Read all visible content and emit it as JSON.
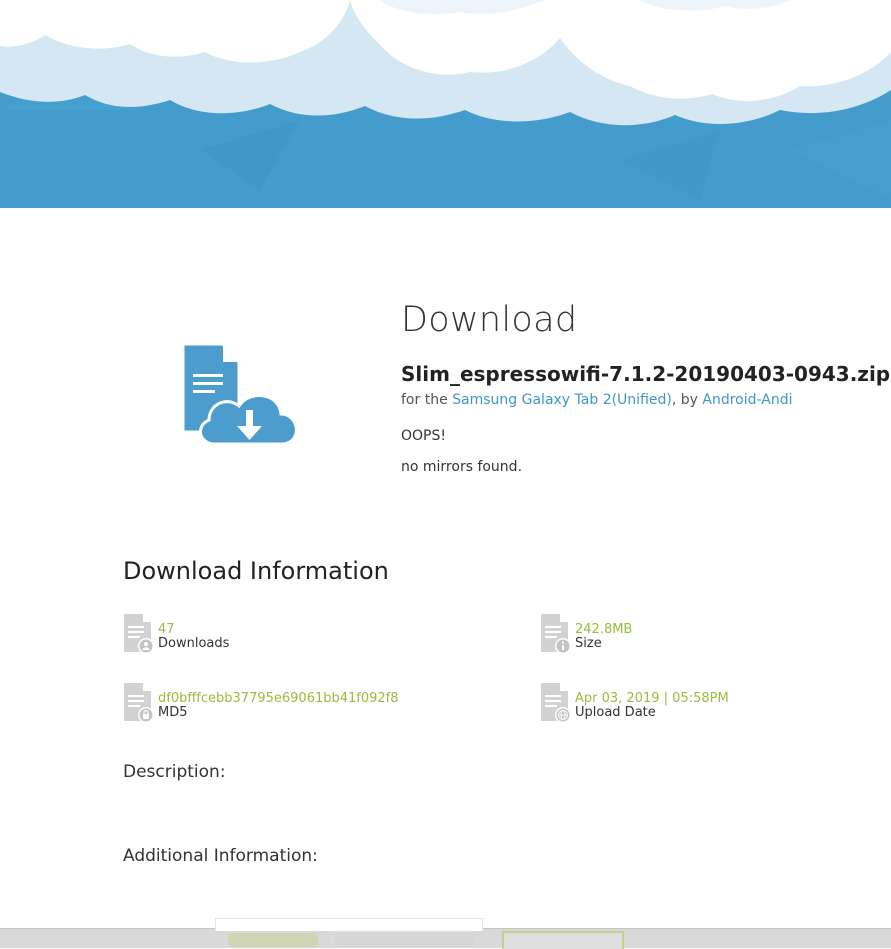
{
  "download": {
    "title": "Download",
    "filename": "Slim_espressowifi-7.1.2-20190403-0943.zip",
    "for_prefix": "for the ",
    "device_link": "Samsung Galaxy Tab 2(Unified)",
    "by_text": ", by ",
    "author_link": "Android-Andi",
    "oops": "OOPS!",
    "no_mirrors": "no mirrors found."
  },
  "info": {
    "title": "Download Information",
    "items": [
      {
        "value": "47",
        "label": "Downloads",
        "badge": "user-icon"
      },
      {
        "value": "242.8MB",
        "label": "Size",
        "badge": "info-icon"
      },
      {
        "value": "df0bfffcebb37795e69061bb41f092f8",
        "label": "MD5",
        "badge": "lock-icon"
      },
      {
        "value": "Apr 03, 2019 | 05:58PM",
        "label": "Upload Date",
        "badge": "globe-icon"
      }
    ]
  },
  "sections": {
    "description": "Description:",
    "additional": "Additional Information:"
  },
  "colors": {
    "hero": "#439ccc",
    "link": "#3e97c9",
    "value": "#97bd3b",
    "icon_gray": "#d2d2d2",
    "doc_blue": "#4c9dce"
  }
}
